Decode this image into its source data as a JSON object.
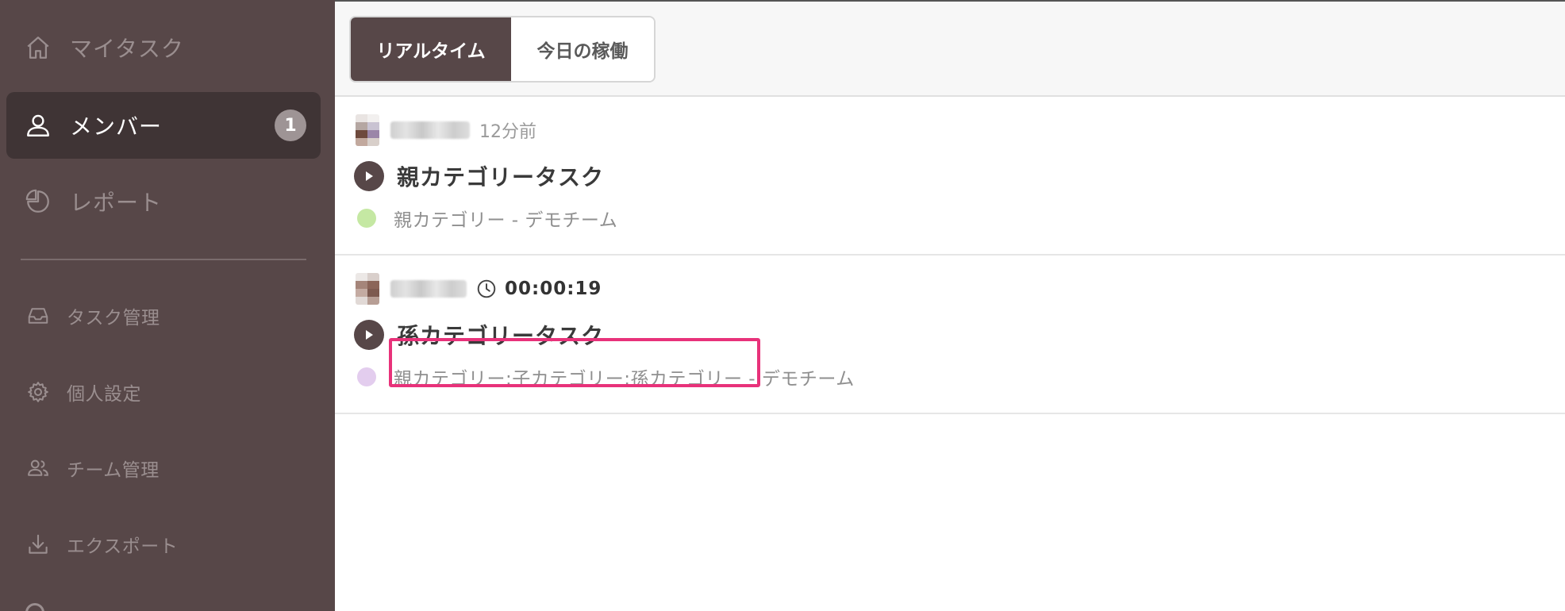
{
  "sidebar": {
    "items": [
      {
        "label": "マイタスク",
        "icon": "home-icon"
      },
      {
        "label": "メンバー",
        "icon": "user-icon",
        "badge": "1"
      },
      {
        "label": "レポート",
        "icon": "pie-chart-icon"
      },
      {
        "label": "タスク管理",
        "icon": "inbox-icon"
      },
      {
        "label": "個人設定",
        "icon": "gear-icon"
      },
      {
        "label": "チーム管理",
        "icon": "team-icon"
      },
      {
        "label": "エクスポート",
        "icon": "download-icon"
      }
    ]
  },
  "header": {
    "tabs": [
      {
        "label": "リアルタイム",
        "active": true
      },
      {
        "label": "今日の稼働",
        "active": false
      }
    ]
  },
  "entries": [
    {
      "time_ago": "12分前",
      "task_title": "親カテゴリータスク",
      "category": "親カテゴリー - デモチーム",
      "category_color": "#c5e8a3"
    },
    {
      "timer": "00:00:19",
      "task_title": "孫カテゴリータスク",
      "category": "親カテゴリー:子カテゴリー:孫カテゴリー - デモチーム",
      "category_color": "#e3cdee"
    }
  ],
  "colors": {
    "sidebar_bg": "#574748",
    "active_bg": "#3f3435",
    "highlight": "#e8327a"
  }
}
